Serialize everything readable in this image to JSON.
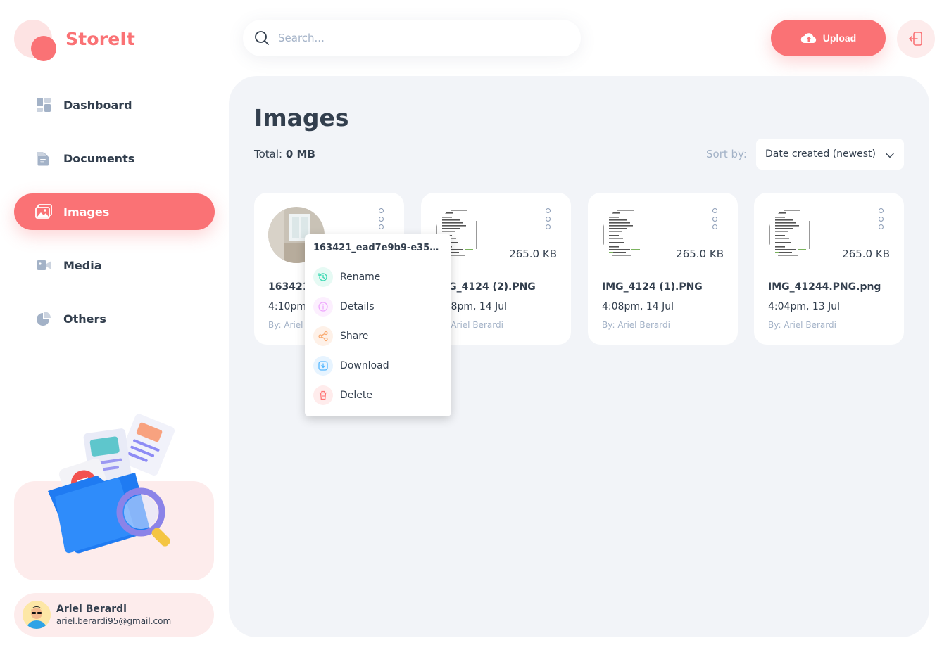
{
  "app": {
    "name": "StoreIt"
  },
  "colors": {
    "brand": "#FA7275",
    "brand_light": "#FDECEC",
    "text": "#333F4E",
    "muted": "#A3B2C7",
    "panel": "#F2F4F8"
  },
  "search": {
    "placeholder": "Search..."
  },
  "header": {
    "upload_label": "Upload"
  },
  "sidebar": {
    "items": [
      {
        "label": "Dashboard",
        "icon": "dashboard-icon",
        "active": false
      },
      {
        "label": "Documents",
        "icon": "documents-icon",
        "active": false
      },
      {
        "label": "Images",
        "icon": "images-icon",
        "active": true
      },
      {
        "label": "Media",
        "icon": "video-icon",
        "active": false
      },
      {
        "label": "Others",
        "icon": "pie-chart-icon",
        "active": false
      }
    ]
  },
  "user": {
    "name": "Ariel Berardi",
    "email": "ariel.berardi95@gmail.com"
  },
  "main": {
    "title": "Images",
    "total_label": "Total:",
    "total_value": "0 MB",
    "sort_label": "Sort by:",
    "sort_value": "Date created (newest)"
  },
  "files": [
    {
      "name": "163421_",
      "size": "",
      "date": "4:10pm,",
      "owner": "By: Ariel",
      "thumb": "room-photo"
    },
    {
      "name": "IMG_4124 (2).PNG",
      "size": "265.0 KB",
      "date": "4:08pm, 14 Jul",
      "owner": "By: Ariel Berardi",
      "thumb": "document-photo"
    },
    {
      "name": "IMG_4124 (1).PNG",
      "size": "265.0 KB",
      "date": "4:08pm, 14 Jul",
      "owner": "By: Ariel Berardi",
      "thumb": "document-photo"
    },
    {
      "name": "IMG_41244.PNG.png",
      "size": "265.0 KB",
      "date": "4:04pm, 13 Jul",
      "owner": "By: Ariel Berardi",
      "thumb": "document-photo"
    }
  ],
  "context_menu": {
    "title": "163421_ead7e9b9-e355...",
    "items": [
      {
        "label": "Rename",
        "icon": "edit-icon",
        "color": "#3DD9B3"
      },
      {
        "label": "Details",
        "icon": "info-icon",
        "color": "#EEA8FD"
      },
      {
        "label": "Share",
        "icon": "share-icon",
        "color": "#F9AB72"
      },
      {
        "label": "Download",
        "icon": "download-icon",
        "color": "#56B8FF"
      },
      {
        "label": "Delete",
        "icon": "trash-icon",
        "color": "#FF7474"
      }
    ]
  }
}
